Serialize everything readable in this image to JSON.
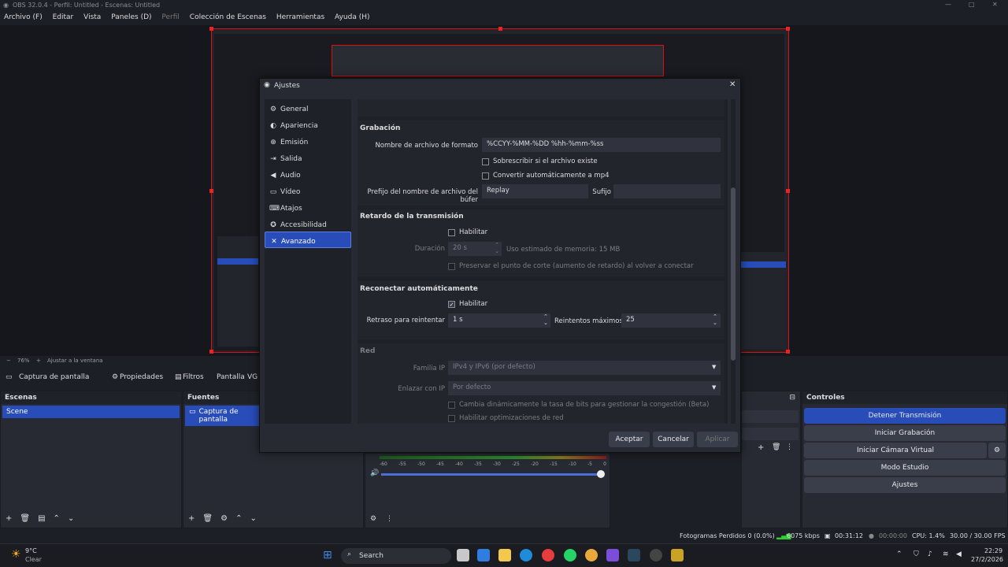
{
  "window_title": "OBS 32.0.4 - Perfil: Untitled - Escenas: Untitled",
  "menu": [
    "Archivo (F)",
    "Editar",
    "Vista",
    "Paneles (D)",
    "Perfil",
    "Colección de Escenas",
    "Herramientas",
    "Ayuda (H)"
  ],
  "preview": {
    "zoom": "76%",
    "fit": "Ajustar a la ventana"
  },
  "source_bar": {
    "source": "Captura de pantalla",
    "properties": "Propiedades",
    "filters": "Filtros",
    "screen": "Pantalla",
    "vg": "VG"
  },
  "scenes": {
    "title": "Escenas",
    "items": [
      "Scene"
    ]
  },
  "sources": {
    "title": "Fuentes",
    "items": [
      "Captura de pantalla"
    ]
  },
  "audio": {
    "ticks": [
      "-60",
      "-55",
      "-50",
      "-45",
      "-40",
      "-35",
      "-30",
      "-25",
      "-20",
      "-15",
      "-10",
      "-5",
      "0"
    ]
  },
  "controls": {
    "title": "Controles",
    "buttons": [
      "Detener Transmisión",
      "Iniciar Grabación",
      "Iniciar Cámara Virtual",
      "Modo Estudio",
      "Ajustes"
    ]
  },
  "dialog": {
    "title": "Ajustes",
    "sidebar": [
      {
        "label": "General",
        "icon": "gear-icon"
      },
      {
        "label": "Apariencia",
        "icon": "palette-icon"
      },
      {
        "label": "Emisión",
        "icon": "broadcast-icon"
      },
      {
        "label": "Salida",
        "icon": "output-icon"
      },
      {
        "label": "Audio",
        "icon": "speaker-icon"
      },
      {
        "label": "Vídeo",
        "icon": "monitor-icon"
      },
      {
        "label": "Atajos",
        "icon": "keyboard-icon"
      },
      {
        "label": "Accesibilidad",
        "icon": "accessibility-icon"
      },
      {
        "label": "Avanzado",
        "icon": "tools-icon"
      }
    ],
    "recording": {
      "title": "Grabación",
      "filename_label": "Nombre de archivo de formato",
      "filename_value": "%CCYY-%MM-%DD %hh-%mm-%ss",
      "overwrite_label": "Sobrescribir si el archivo existe",
      "remux_label": "Convertir automáticamente a mp4",
      "replay_prefix_label": "Prefijo del nombre de archivo del búfer",
      "replay_prefix_value": "Replay",
      "suffix_label": "Sufijo",
      "suffix_value": ""
    },
    "delay": {
      "title": "Retardo de la transmisión",
      "enable_label": "Habilitar",
      "duration_label": "Duración",
      "duration_value": "20 s",
      "memory_text": "Uso estimado de memoria: 15 MB",
      "preserve_label": "Preservar el punto de corte (aumento de retardo) al volver a conectar"
    },
    "reconnect": {
      "title": "Reconectar automáticamente",
      "enable_label": "Habilitar",
      "retry_delay_label": "Retraso para reintentar",
      "retry_delay_value": "1 s",
      "max_retries_label": "Reintentos máximos",
      "max_retries_value": "25"
    },
    "network": {
      "title": "Red",
      "ip_family_label": "Familia IP",
      "ip_family_value": "IPv4 y IPv6 (por defecto)",
      "bind_label": "Enlazar con IP",
      "bind_value": "Por defecto",
      "dynamic_bitrate_label": "Cambia dinámicamente la tasa de bits para gestionar la congestión (Beta)",
      "optimizations_label": "Habilitar optimizaciones de red"
    },
    "buttons": {
      "accept": "Aceptar",
      "cancel": "Cancelar",
      "apply": "Aplicar"
    }
  },
  "status": {
    "dropped": "Fotogramas Perdidos 0 (0.0%)",
    "bitrate": "6075 kbps",
    "stream_time": "00:31:12",
    "rec_time": "00:00:00",
    "cpu": "CPU: 1.4%",
    "fps": "30.00 / 30.00 FPS"
  },
  "taskbar": {
    "weather_temp": "9°C",
    "weather_desc": "Clear",
    "search": "Search",
    "time": "22:29",
    "date": "27/2/2026"
  }
}
